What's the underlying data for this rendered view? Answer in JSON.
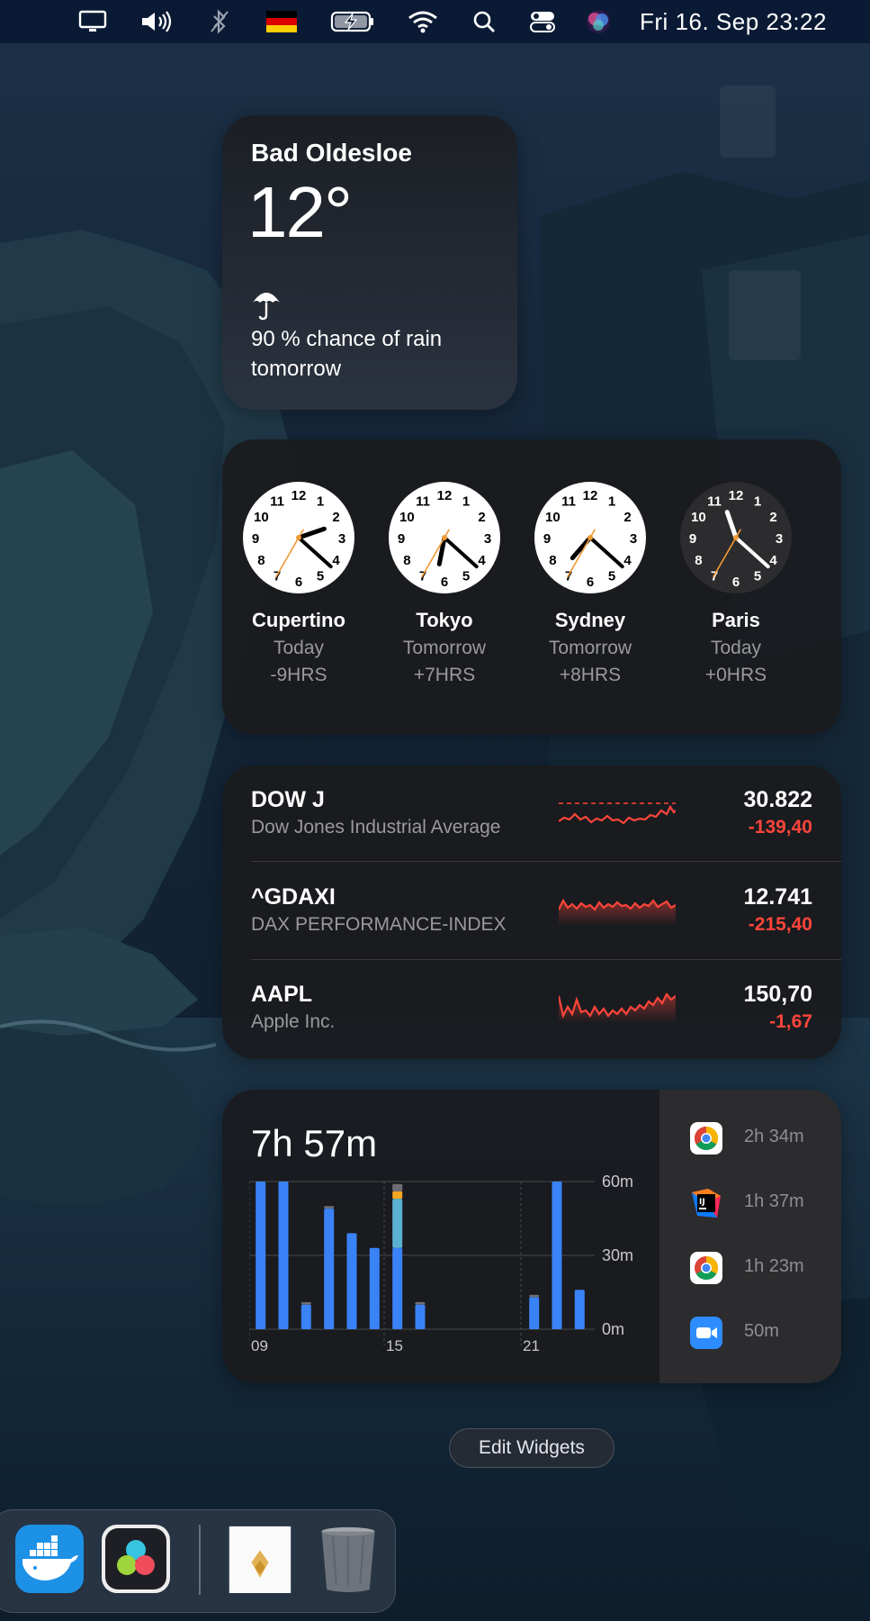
{
  "menubar": {
    "icons": [
      "display-icon",
      "volume-icon",
      "bluetooth-icon",
      "german-flag-icon",
      "battery-charging-icon",
      "wifi-icon",
      "search-icon",
      "control-center-icon",
      "siri-icon"
    ],
    "datetime": "Fri 16. Sep  23:22"
  },
  "weather": {
    "city": "Bad Oldesloe",
    "temperature": "12°",
    "condition_icon": "umbrella-icon",
    "forecast": "90 % chance of rain tomorrow"
  },
  "world_clock": {
    "clocks": [
      {
        "city": "Cupertino",
        "day": "Today",
        "offset": "-9HRS",
        "time": "14:22",
        "theme": "light"
      },
      {
        "city": "Tokyo",
        "day": "Tomorrow",
        "offset": "+7HRS",
        "time": "06:22",
        "theme": "light"
      },
      {
        "city": "Sydney",
        "day": "Tomorrow",
        "offset": "+8HRS",
        "time": "07:22",
        "theme": "light"
      },
      {
        "city": "Paris",
        "day": "Today",
        "offset": "+0HRS",
        "time": "23:22",
        "theme": "dark"
      }
    ]
  },
  "stocks": {
    "items": [
      {
        "symbol": "DOW J",
        "name": "Dow Jones Industrial Average",
        "price": "30.822",
        "change": "-139,40",
        "icon": "sparkline-icon"
      },
      {
        "symbol": "^GDAXI",
        "name": "DAX PERFORMANCE-INDEX",
        "price": "12.741",
        "change": "-215,40",
        "icon": "sparkline-icon"
      },
      {
        "symbol": "AAPL",
        "name": "Apple Inc.",
        "price": "150,70",
        "change": "-1,67",
        "icon": "sparkline-icon"
      }
    ],
    "change_color": "#ff453a"
  },
  "screen_time": {
    "total": "7h 57m",
    "apps": [
      {
        "icon": "chrome-icon",
        "duration": "2h 34m"
      },
      {
        "icon": "intellij-icon",
        "duration": "1h 37m"
      },
      {
        "icon": "chrome-icon",
        "duration": "1h 23m"
      },
      {
        "icon": "zoom-icon",
        "duration": "50m"
      }
    ],
    "chart_data": {
      "type": "bar",
      "x_tick_labels": [
        "09",
        "15",
        "21"
      ],
      "y_tick_labels": [
        "60m",
        "30m",
        "0m"
      ],
      "ylim": [
        0,
        60
      ],
      "hours": [
        9,
        10,
        11,
        12,
        13,
        14,
        15,
        16,
        17,
        18,
        19,
        20,
        21,
        22,
        23
      ],
      "series": [
        {
          "values": [
            60,
            60,
            10,
            49,
            39,
            33,
            33,
            10,
            0,
            0,
            0,
            0,
            13,
            60,
            16
          ],
          "color": "#3a82f7"
        },
        {
          "values": [
            0,
            0,
            0,
            0,
            0,
            0,
            20,
            0,
            0,
            0,
            0,
            0,
            0,
            0,
            0
          ],
          "color": "#5ab1d2"
        },
        {
          "values": [
            0,
            0,
            0,
            0,
            0,
            0,
            3,
            0,
            0,
            0,
            0,
            0,
            0,
            0,
            0
          ],
          "color": "#f5a623"
        },
        {
          "values": [
            0,
            0,
            1,
            1,
            0,
            0,
            3,
            1,
            0,
            0,
            0,
            0,
            1,
            0,
            0
          ],
          "color": "#6e6e73"
        }
      ]
    }
  },
  "edit_widgets_label": "Edit Widgets",
  "dock": {
    "items": [
      "docker-icon",
      "davinci-resolve-icon",
      "document-icon",
      "trash-icon"
    ]
  }
}
